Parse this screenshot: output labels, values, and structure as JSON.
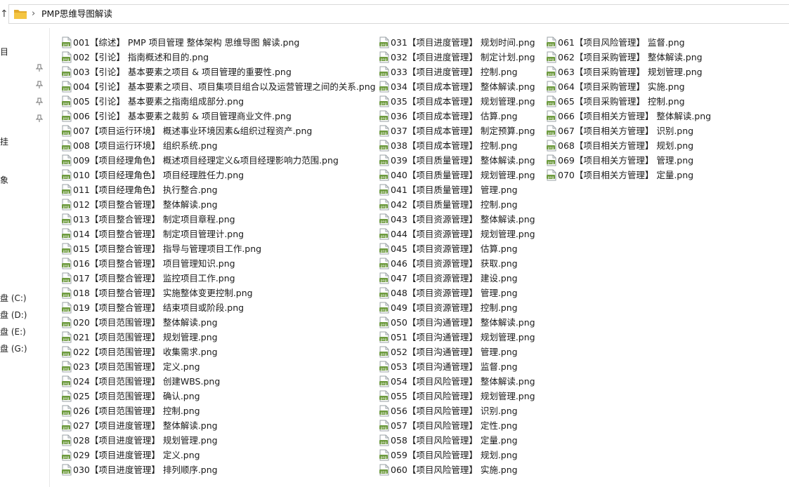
{
  "address": {
    "up_glyph": "↑",
    "chevron": "›",
    "path": "PMP思维导图解读"
  },
  "nav_fragments": [
    {
      "text": "目"
    },
    {
      "text": "挂"
    },
    {
      "text": "象"
    },
    {
      "text": "盘 (C:)"
    },
    {
      "text": "盘 (D:)"
    },
    {
      "text": "盘 (E:)"
    },
    {
      "text": "盘 (G:)"
    }
  ],
  "colors": {
    "folder": "#f4c542",
    "folder_dark": "#e2a92b",
    "file_icon": "#6d9a3e",
    "pin": "#8a8a8a"
  },
  "files": [
    "001【综述】 PMP 项目管理 整体架构 思维导图 解读.png",
    "002【引论】 指南概述和目的.png",
    "003【引论】 基本要素之项目 & 项目管理的重要性.png",
    "004【引论】 基本要素之项目、项目集项目组合以及运营管理之间的关系.png",
    "005【引论】 基本要素之指南组成部分.png",
    "006【引论】 基本要素之裁剪 & 项目管理商业文件.png",
    "007【项目运行环境】 概述事业环境因素&组织过程资产.png",
    "008【项目运行环境】 组织系统.png",
    "009【项目经理角色】 概述项目经理定义&项目经理影响力范围.png",
    "010【项目经理角色】 项目经理胜任力.png",
    "011【项目经理角色】 执行整合.png",
    "012【项目整合管理】 整体解读.png",
    "013【项目整合管理】 制定项目章程.png",
    "014【项目整合管理】 制定项目管理计.png",
    "015【项目整合管理】 指导与管理项目工作.png",
    "016【项目整合管理】 项目管理知识.png",
    "017【项目整合管理】 监控项目工作.png",
    "018【项目整合管理】 实施整体变更控制.png",
    "019【项目整合管理】 结束项目或阶段.png",
    "020【项目范围管理】 整体解读.png",
    "021【项目范围管理】 规划管理.png",
    "022【项目范围管理】 收集需求.png",
    "023【项目范围管理】 定义.png",
    "024【项目范围管理】 创建WBS.png",
    "025【项目范围管理】 确认.png",
    "026【项目范围管理】 控制.png",
    "027【项目进度管理】 整体解读.png",
    "028【项目进度管理】 规划管理.png",
    "029【项目进度管理】 定义.png",
    "030【项目进度管理】 排列顺序.png",
    "031【项目进度管理】 规划时间.png",
    "032【项目进度管理】 制定计划.png",
    "033【项目进度管理】 控制.png",
    "034【项目成本管理】 整体解读.png",
    "035【项目成本管理】 规划管理.png",
    "036【项目成本管理】 估算.png",
    "037【项目成本管理】 制定预算.png",
    "038【项目成本管理】 控制.png",
    "039【项目质量管理】 整体解读.png",
    "040【项目质量管理】 规划管理.png",
    "041【项目质量管理】 管理.png",
    "042【项目质量管理】 控制.png",
    "043【项目资源管理】 整体解读.png",
    "044【项目资源管理】 规划管理.png",
    "045【项目资源管理】 估算.png",
    "046【项目资源管理】 获取.png",
    "047【项目资源管理】 建设.png",
    "048【项目资源管理】 管理.png",
    "049【项目资源管理】 控制.png",
    "050【项目沟通管理】 整体解读.png",
    "051【项目沟通管理】 规划管理.png",
    "052【项目沟通管理】 管理.png",
    "053【项目沟通管理】 监督.png",
    "054【项目风险管理】 整体解读.png",
    "055【项目风险管理】 规划管理.png",
    "056【项目风险管理】 识别.png",
    "057【项目风险管理】 定性.png",
    "058【项目风险管理】 定量.png",
    "059【项目风险管理】 规划.png",
    "060【项目风险管理】 实施.png",
    "061【项目风险管理】 监督.png",
    "062【项目采购管理】 整体解读.png",
    "063【项目采购管理】 规划管理.png",
    "064【项目采购管理】 实施.png",
    "065【项目采购管理】 控制.png",
    "066【项目相关方管理】 整体解读.png",
    "067【项目相关方管理】 识别.png",
    "068【项目相关方管理】 规划.png",
    "069【项目相关方管理】 管理.png",
    "070【项目相关方管理】 定量.png"
  ]
}
